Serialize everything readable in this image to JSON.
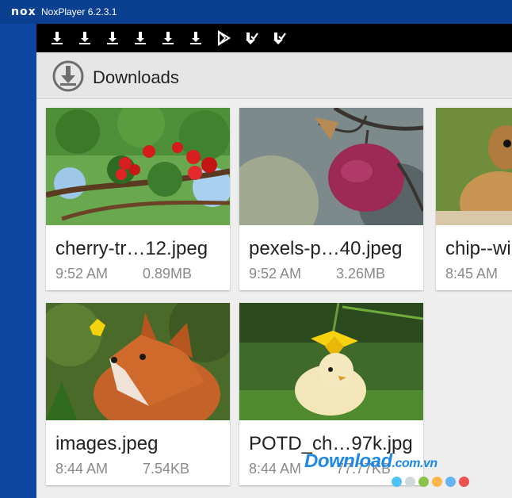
{
  "window": {
    "logo": "nox",
    "title": "NoxPlayer 6.2.3.1"
  },
  "statusbar": {
    "icons": [
      "download-icon",
      "download-icon",
      "download-icon",
      "download-icon",
      "download-icon",
      "download-icon",
      "play-store-icon",
      "download-done-icon",
      "download-done-icon"
    ]
  },
  "appbar": {
    "title": "Downloads",
    "icon": "download-icon"
  },
  "files": [
    {
      "name": "cherry-tr…12.jpeg",
      "time": "9:52 AM",
      "size": "0.89MB"
    },
    {
      "name": "pexels-p…40.jpeg",
      "time": "9:52 AM",
      "size": "3.26MB"
    },
    {
      "name": "chip--wi",
      "time": "8:45 AM",
      "size": ""
    },
    {
      "name": "images.jpeg",
      "time": "8:44 AM",
      "size": "7.54KB"
    },
    {
      "name": "POTD_ch…97k.jpg",
      "time": "8:44 AM",
      "size": "77.77KB"
    }
  ],
  "watermark": {
    "text": "Download",
    "suffix": ".com.vn"
  },
  "colors": {
    "nox_blue": "#0d47a1",
    "watermark_blue": "#1e88e5"
  }
}
